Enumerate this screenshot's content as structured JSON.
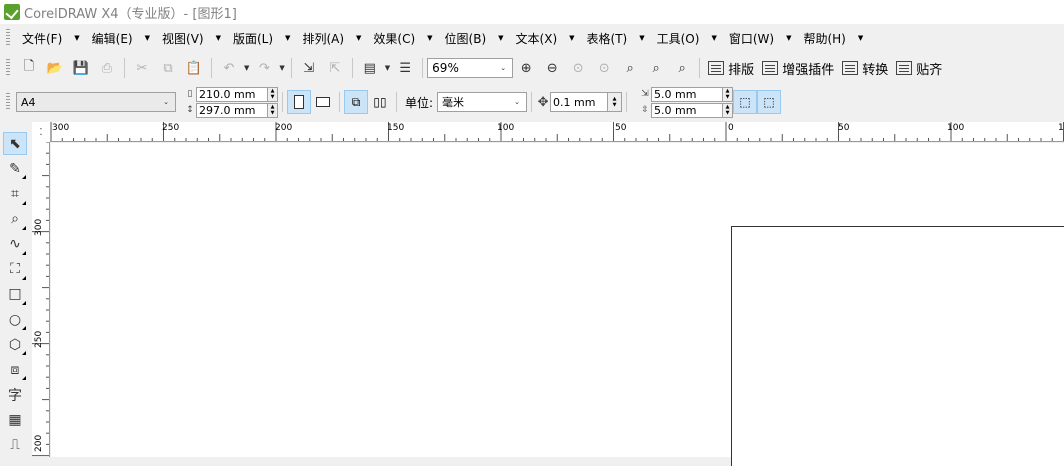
{
  "window": {
    "title": "CorelDRAW X4（专业版）- [图形1]"
  },
  "menu": [
    {
      "label": "文件(F)"
    },
    {
      "label": "编辑(E)"
    },
    {
      "label": "视图(V)"
    },
    {
      "label": "版面(L)"
    },
    {
      "label": "排列(A)"
    },
    {
      "label": "效果(C)"
    },
    {
      "label": "位图(B)"
    },
    {
      "label": "文本(X)"
    },
    {
      "label": "表格(T)"
    },
    {
      "label": "工具(O)"
    },
    {
      "label": "窗口(W)"
    },
    {
      "label": "帮助(H)"
    }
  ],
  "toolbar": {
    "zoom_value": "69%",
    "layout_label": "排版",
    "plugin_label": "增强插件",
    "convert_label": "转换",
    "snap_label": "贴齐"
  },
  "propbar": {
    "paper_size": "A4",
    "width": "210.0 mm",
    "height": "297.0 mm",
    "unit_label": "单位:",
    "unit_value": "毫米",
    "nudge": "0.1 mm",
    "dup_x": "5.0 mm",
    "dup_y": "5.0 mm"
  },
  "hruler_labels": [
    "300",
    "250",
    "200",
    "150",
    "100",
    "50",
    "0",
    "50",
    "100",
    "1"
  ],
  "vruler_labels": [
    "300",
    "250",
    "200"
  ],
  "toolbox": {
    "text_tool": "字"
  }
}
